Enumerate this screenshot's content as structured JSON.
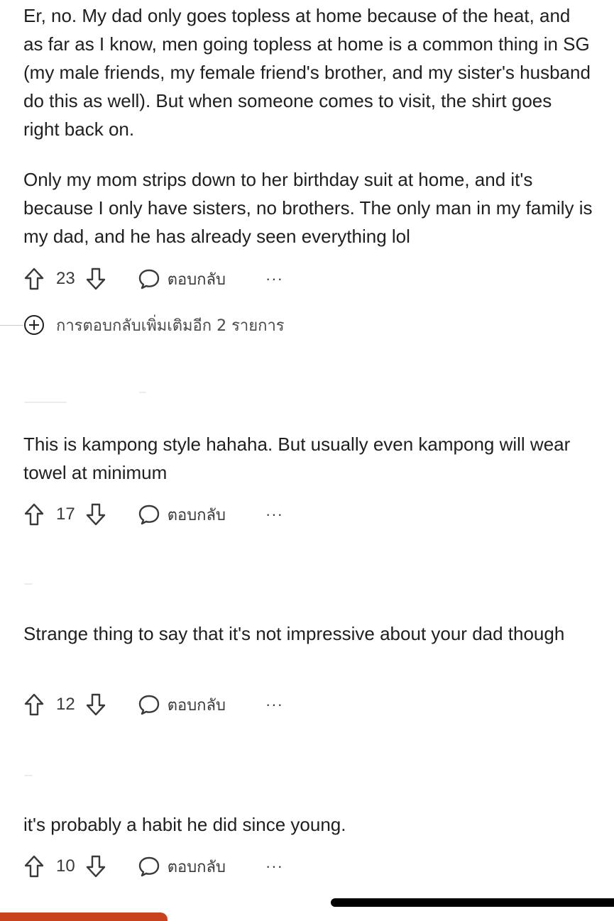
{
  "comments": [
    {
      "paragraphs": [
        "Er, no. My dad only goes topless at home because of the heat, and as far as I know, men going topless at home is a common thing in SG (my male friends, my female friend's brother, and my sister's husband do this as well). But when someone comes to visit, the shirt goes right back on.",
        "Only my mom strips down to her birthday suit at home, and it's because I only have sisters, no brothers. The only man in my family is my dad, and he has already seen everything lol"
      ],
      "votes": "23",
      "reply_label": "ตอบกลับ",
      "more_label": "···"
    },
    {
      "paragraphs": [
        "This is kampong style hahaha. But usually even kampong will wear towel at minimum"
      ],
      "votes": "17",
      "reply_label": "ตอบกลับ",
      "more_label": "···"
    },
    {
      "paragraphs": [
        "Strange thing to say that it's not impressive about your dad though"
      ],
      "votes": "12",
      "reply_label": "ตอบกลับ",
      "more_label": "···"
    },
    {
      "paragraphs": [
        "it's probably a habit he did since young."
      ],
      "votes": "10",
      "reply_label": "ตอบกลับ",
      "more_label": "···"
    }
  ],
  "more_replies": {
    "label": "การตอบกลับเพิ่มเติมอีก 2 รายการ"
  },
  "colors": {
    "text": "#1f1f1f",
    "meta": "#3a3a3a",
    "accent_bar": "#c8431d"
  },
  "icons": {
    "upvote": "arrow-up-outline-icon",
    "downvote": "arrow-down-outline-icon",
    "reply": "speech-bubble-icon",
    "more": "ellipsis-icon",
    "expand": "plus-circle-icon"
  }
}
